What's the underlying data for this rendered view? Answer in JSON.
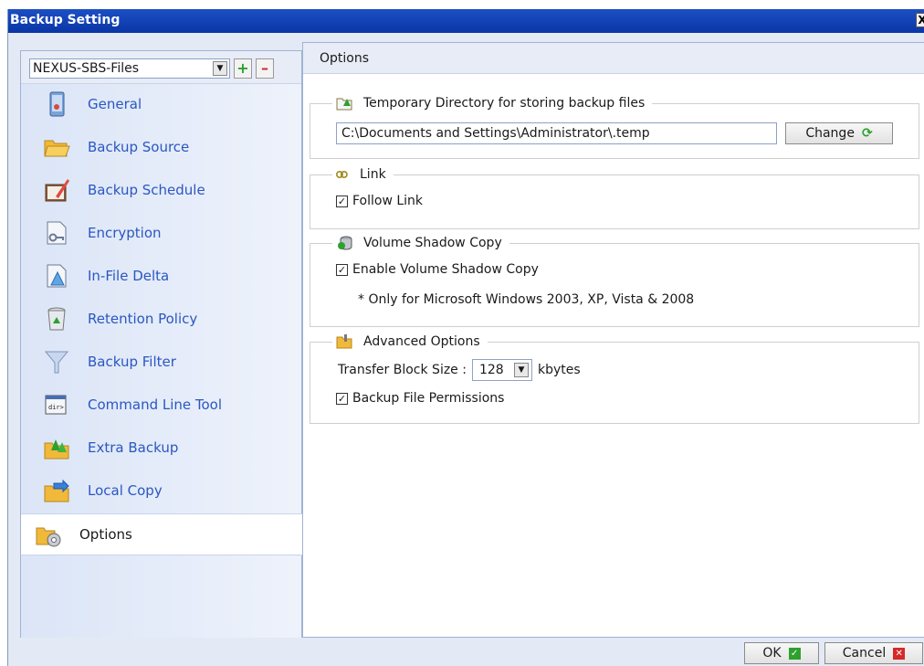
{
  "window": {
    "title": "Backup Setting",
    "close_glyph": "X"
  },
  "sidebar": {
    "backupset": "NEXUS-SBS-Files",
    "add_label": "+",
    "remove_label": "–",
    "items": [
      {
        "label": "General",
        "icon": "general-icon"
      },
      {
        "label": "Backup Source",
        "icon": "folder-icon"
      },
      {
        "label": "Backup Schedule",
        "icon": "schedule-icon"
      },
      {
        "label": "Encryption",
        "icon": "key-icon"
      },
      {
        "label": "In-File Delta",
        "icon": "delta-icon"
      },
      {
        "label": "Retention Policy",
        "icon": "recycle-bin-icon"
      },
      {
        "label": "Backup Filter",
        "icon": "filter-icon"
      },
      {
        "label": "Command Line Tool",
        "icon": "command-line-icon"
      },
      {
        "label": "Extra Backup",
        "icon": "extra-backup-icon"
      },
      {
        "label": "Local Copy",
        "icon": "local-copy-icon"
      },
      {
        "label": "Options",
        "icon": "options-icon",
        "active": true
      }
    ]
  },
  "main": {
    "title": "Options",
    "temp_dir": {
      "legend": "Temporary Directory for storing backup files",
      "path": "C:\\Documents and Settings\\Administrator\\.temp",
      "change_label": "Change"
    },
    "link": {
      "legend": "Link",
      "follow_label": "Follow Link",
      "follow_checked": true
    },
    "vss": {
      "legend": "Volume Shadow Copy",
      "enable_label": "Enable Volume Shadow Copy",
      "enable_checked": true,
      "note": "* Only for Microsoft Windows 2003, XP, Vista & 2008"
    },
    "advanced": {
      "legend": "Advanced Options",
      "block_label": "Transfer Block Size :",
      "block_value": "128",
      "block_unit": "kbytes",
      "perm_label": "Backup File Permissions",
      "perm_checked": true
    }
  },
  "footer": {
    "ok_label": "OK",
    "cancel_label": "Cancel"
  },
  "colors": {
    "title_bar": "#0a36a6",
    "link_blue": "#2a57c2",
    "ok_green": "#2ea02e",
    "cancel_red": "#d42a2a"
  }
}
